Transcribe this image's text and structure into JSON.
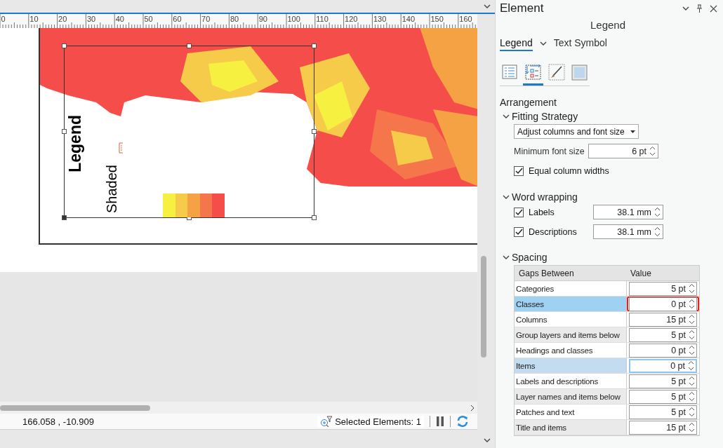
{
  "ruler": {
    "labels": [
      "0",
      "10",
      "20",
      "30",
      "40",
      "50",
      "60",
      "70",
      "80",
      "90",
      "100",
      "110",
      "120",
      "130",
      "140",
      "150",
      "160"
    ]
  },
  "layout": {
    "legend": {
      "title": "Legend",
      "layer": "Shaded",
      "overflow": true,
      "classes": [
        {
          "color": "#f6f140"
        },
        {
          "color": "#f7cb4a"
        },
        {
          "color": "#f5a244"
        },
        {
          "color": "#f5764a"
        },
        {
          "color": "#f44d4a"
        }
      ]
    }
  },
  "status_bar": {
    "coordinates": "166.058 , -10.909",
    "selection": "Selected Elements: 1"
  },
  "panel": {
    "title": "Element",
    "subtitle": "Legend",
    "tabs": [
      {
        "label": "Legend",
        "selected": true
      },
      {
        "label": "Text Symbol",
        "selected": false
      }
    ],
    "icon_tabs": [
      {
        "kind": "list",
        "selected": false
      },
      {
        "kind": "arrange",
        "selected": true
      },
      {
        "kind": "brush",
        "selected": false
      },
      {
        "kind": "frame",
        "selected": false
      }
    ],
    "section": "Arrangement",
    "fitting": {
      "title": "Fitting Strategy",
      "expanded": true,
      "strategy": "Adjust columns and font size",
      "min_font_label": "Minimum font size",
      "min_font": "6 pt",
      "equal_widths": {
        "label": "Equal column widths",
        "checked": true
      }
    },
    "wrapping": {
      "title": "Word wrapping",
      "expanded": true,
      "items": [
        {
          "label": "Labels",
          "checked": true,
          "value": "38.1 mm"
        },
        {
          "label": "Descriptions",
          "checked": true,
          "value": "38.1 mm"
        }
      ]
    },
    "spacing": {
      "title": "Spacing",
      "expanded": true,
      "columns": [
        "Gaps Between",
        "Value"
      ],
      "rows": [
        {
          "label": "Categories",
          "value": "5 pt",
          "selected": false,
          "focused": false,
          "annotated": false
        },
        {
          "label": "Classes",
          "value": "0 pt",
          "selected": true,
          "focused": false,
          "annotated": true
        },
        {
          "label": "Columns",
          "value": "15 pt",
          "selected": false,
          "focused": false,
          "annotated": false
        },
        {
          "label": "Group layers and items below",
          "value": "5 pt",
          "selected": false,
          "focused": false,
          "annotated": false
        },
        {
          "label": "Headings and classes",
          "value": "0 pt",
          "selected": false,
          "focused": false,
          "annotated": false
        },
        {
          "label": "Items",
          "value": "0 pt",
          "selected": false,
          "focused": true,
          "annotated": false
        },
        {
          "label": "Labels and descriptions",
          "value": "5 pt",
          "selected": false,
          "focused": false,
          "annotated": false
        },
        {
          "label": "Layer names and items below",
          "value": "5 pt",
          "selected": false,
          "focused": false,
          "annotated": false
        },
        {
          "label": "Patches and text",
          "value": "5 pt",
          "selected": false,
          "focused": false,
          "annotated": false
        },
        {
          "label": "Title and items",
          "value": "15 pt",
          "selected": false,
          "focused": false,
          "annotated": false
        }
      ]
    }
  }
}
